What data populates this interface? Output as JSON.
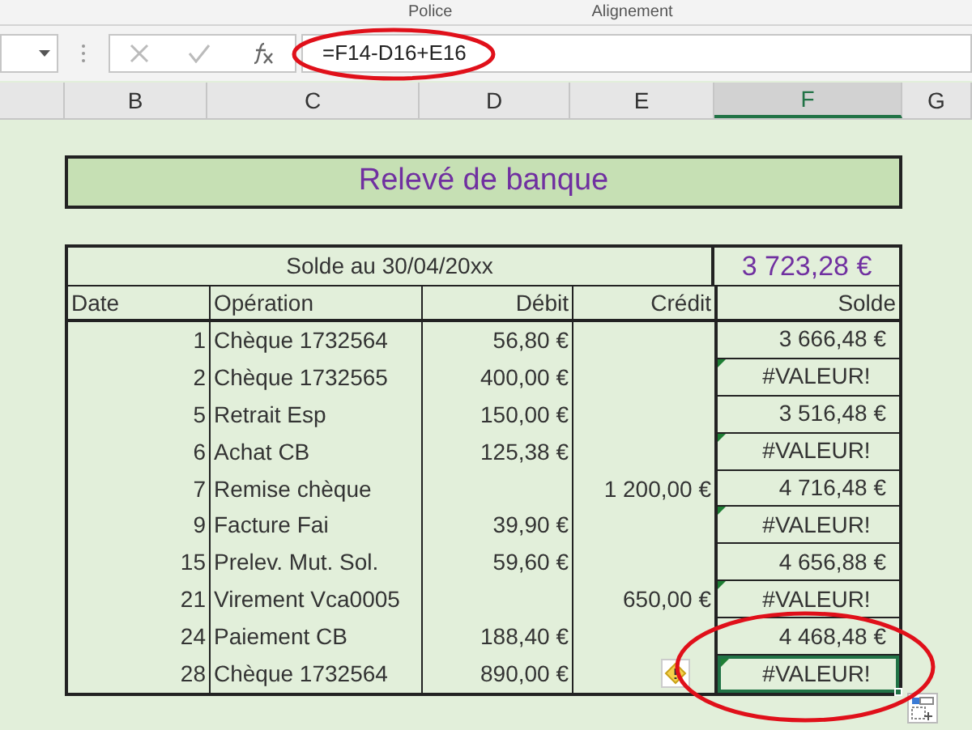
{
  "ribbon_groups": [
    "Police",
    "Alignement"
  ],
  "formula_bar": {
    "formula": "=F14-D16+E16"
  },
  "column_headers": [
    {
      "label": "B",
      "selected": false
    },
    {
      "label": "C",
      "selected": false
    },
    {
      "label": "D",
      "selected": false
    },
    {
      "label": "E",
      "selected": false
    },
    {
      "label": "F",
      "selected": true
    },
    {
      "label": "G",
      "selected": false
    }
  ],
  "title": "Relevé de banque",
  "balance": {
    "label": "Solde au 30/04/20xx",
    "value": "3 723,28 €"
  },
  "table": {
    "columns": [
      "Date",
      "Opération",
      "Débit",
      "Crédit",
      "Solde"
    ],
    "rows": [
      {
        "date": "1",
        "operation": "Chèque 1732564",
        "debit": "56,80 €",
        "balance": "3 666,48 €",
        "error_flag": false,
        "selected": false
      },
      {
        "date": "2",
        "operation": "Chèque 1732565",
        "debit": "400,00 €",
        "balance": "#VALEUR!",
        "error_flag": true,
        "selected": false
      },
      {
        "date": "5",
        "operation": "Retrait Esp",
        "debit": "150,00 €",
        "balance": "3 516,48 €",
        "error_flag": false,
        "selected": false
      },
      {
        "date": "6",
        "operation": "Achat CB",
        "debit": "125,38 €",
        "balance": "#VALEUR!",
        "error_flag": true,
        "selected": false
      },
      {
        "date": "7",
        "operation": "Remise chèque",
        "credit": "1 200,00 €",
        "balance": "4 716,48 €",
        "error_flag": false,
        "selected": false
      },
      {
        "date": "9",
        "operation": "Facture Fai",
        "debit": "39,90 €",
        "balance": "#VALEUR!",
        "error_flag": true,
        "selected": false
      },
      {
        "date": "15",
        "operation": "Prelev. Mut. Sol.",
        "debit": "59,60 €",
        "balance": "4 656,88 €",
        "error_flag": false,
        "selected": false
      },
      {
        "date": "21",
        "operation": "Virement Vca0005",
        "credit": "650,00 €",
        "balance": "#VALEUR!",
        "error_flag": true,
        "selected": false
      },
      {
        "date": "24",
        "operation": "Paiement CB",
        "debit": "188,40 €",
        "balance": "4 468,48 €",
        "error_flag": false,
        "selected": false
      },
      {
        "date": "28",
        "operation": "Chèque 1732564",
        "debit": "890,00 €",
        "balance": "#VALEUR!",
        "error_flag": true,
        "selected": true
      }
    ]
  }
}
